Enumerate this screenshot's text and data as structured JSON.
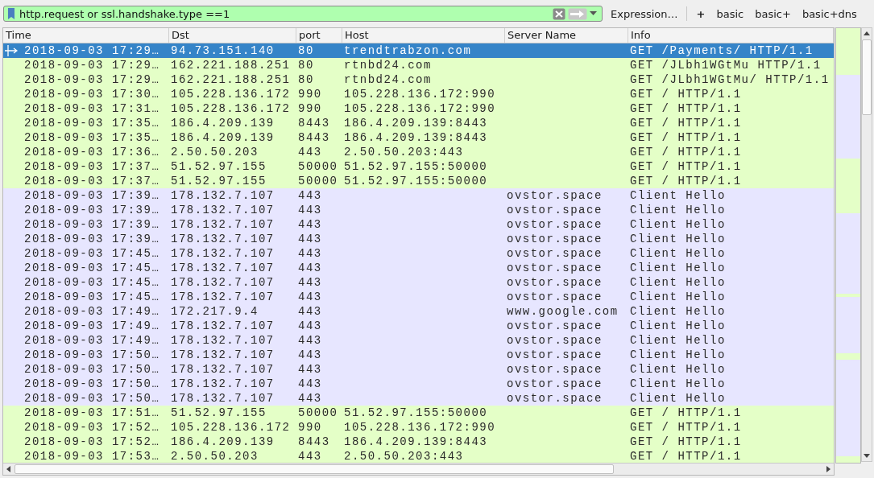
{
  "filter_bar": {
    "value": "http.request or ssl.handshake.type ==1",
    "expression_button": "Expression…",
    "add_button": "+",
    "buttons": [
      "basic",
      "basic+",
      "basic+dns"
    ]
  },
  "table": {
    "columns": [
      "Time",
      "Dst",
      "port",
      "Host",
      "Server Name",
      "Info"
    ],
    "rows": [
      {
        "kind": "http",
        "selected": true,
        "cells": [
          "2018-09-03 17:29…",
          "94.73.151.140",
          "80",
          "trendtrabzon.com",
          "",
          "GET /Payments/ HTTP/1.1"
        ]
      },
      {
        "kind": "http",
        "selected": false,
        "cells": [
          "2018-09-03 17:29…",
          "162.221.188.251",
          "80",
          "rtnbd24.com",
          "",
          "GET /JLbh1WGtMu HTTP/1.1"
        ]
      },
      {
        "kind": "http",
        "selected": false,
        "cells": [
          "2018-09-03 17:29…",
          "162.221.188.251",
          "80",
          "rtnbd24.com",
          "",
          "GET /JLbh1WGtMu/ HTTP/1.1"
        ]
      },
      {
        "kind": "http",
        "selected": false,
        "cells": [
          "2018-09-03 17:30…",
          "105.228.136.172",
          "990",
          "105.228.136.172:990",
          "",
          "GET / HTTP/1.1"
        ]
      },
      {
        "kind": "http",
        "selected": false,
        "cells": [
          "2018-09-03 17:31…",
          "105.228.136.172",
          "990",
          "105.228.136.172:990",
          "",
          "GET / HTTP/1.1"
        ]
      },
      {
        "kind": "http",
        "selected": false,
        "cells": [
          "2018-09-03 17:35…",
          "186.4.209.139",
          "8443",
          "186.4.209.139:8443",
          "",
          "GET / HTTP/1.1"
        ]
      },
      {
        "kind": "http",
        "selected": false,
        "cells": [
          "2018-09-03 17:35…",
          "186.4.209.139",
          "8443",
          "186.4.209.139:8443",
          "",
          "GET / HTTP/1.1"
        ]
      },
      {
        "kind": "http",
        "selected": false,
        "cells": [
          "2018-09-03 17:36…",
          "2.50.50.203",
          "443",
          "2.50.50.203:443",
          "",
          "GET / HTTP/1.1"
        ]
      },
      {
        "kind": "http",
        "selected": false,
        "cells": [
          "2018-09-03 17:37…",
          "51.52.97.155",
          "50000",
          "51.52.97.155:50000",
          "",
          "GET / HTTP/1.1"
        ]
      },
      {
        "kind": "http",
        "selected": false,
        "cells": [
          "2018-09-03 17:37…",
          "51.52.97.155",
          "50000",
          "51.52.97.155:50000",
          "",
          "GET / HTTP/1.1"
        ]
      },
      {
        "kind": "tls",
        "selected": false,
        "cells": [
          "2018-09-03 17:39…",
          "178.132.7.107",
          "443",
          "",
          "ovstor.space",
          "Client Hello"
        ]
      },
      {
        "kind": "tls",
        "selected": false,
        "cells": [
          "2018-09-03 17:39…",
          "178.132.7.107",
          "443",
          "",
          "ovstor.space",
          "Client Hello"
        ]
      },
      {
        "kind": "tls",
        "selected": false,
        "cells": [
          "2018-09-03 17:39…",
          "178.132.7.107",
          "443",
          "",
          "ovstor.space",
          "Client Hello"
        ]
      },
      {
        "kind": "tls",
        "selected": false,
        "cells": [
          "2018-09-03 17:39…",
          "178.132.7.107",
          "443",
          "",
          "ovstor.space",
          "Client Hello"
        ]
      },
      {
        "kind": "tls",
        "selected": false,
        "cells": [
          "2018-09-03 17:45…",
          "178.132.7.107",
          "443",
          "",
          "ovstor.space",
          "Client Hello"
        ]
      },
      {
        "kind": "tls",
        "selected": false,
        "cells": [
          "2018-09-03 17:45…",
          "178.132.7.107",
          "443",
          "",
          "ovstor.space",
          "Client Hello"
        ]
      },
      {
        "kind": "tls",
        "selected": false,
        "cells": [
          "2018-09-03 17:45…",
          "178.132.7.107",
          "443",
          "",
          "ovstor.space",
          "Client Hello"
        ]
      },
      {
        "kind": "tls",
        "selected": false,
        "cells": [
          "2018-09-03 17:45…",
          "178.132.7.107",
          "443",
          "",
          "ovstor.space",
          "Client Hello"
        ]
      },
      {
        "kind": "tls",
        "selected": false,
        "cells": [
          "2018-09-03 17:49…",
          "172.217.9.4",
          "443",
          "",
          "www.google.com",
          "Client Hello"
        ]
      },
      {
        "kind": "tls",
        "selected": false,
        "cells": [
          "2018-09-03 17:49…",
          "178.132.7.107",
          "443",
          "",
          "ovstor.space",
          "Client Hello"
        ]
      },
      {
        "kind": "tls",
        "selected": false,
        "cells": [
          "2018-09-03 17:49…",
          "178.132.7.107",
          "443",
          "",
          "ovstor.space",
          "Client Hello"
        ]
      },
      {
        "kind": "tls",
        "selected": false,
        "cells": [
          "2018-09-03 17:50…",
          "178.132.7.107",
          "443",
          "",
          "ovstor.space",
          "Client Hello"
        ]
      },
      {
        "kind": "tls",
        "selected": false,
        "cells": [
          "2018-09-03 17:50…",
          "178.132.7.107",
          "443",
          "",
          "ovstor.space",
          "Client Hello"
        ]
      },
      {
        "kind": "tls",
        "selected": false,
        "cells": [
          "2018-09-03 17:50…",
          "178.132.7.107",
          "443",
          "",
          "ovstor.space",
          "Client Hello"
        ]
      },
      {
        "kind": "tls",
        "selected": false,
        "cells": [
          "2018-09-03 17:50…",
          "178.132.7.107",
          "443",
          "",
          "ovstor.space",
          "Client Hello"
        ]
      },
      {
        "kind": "http",
        "selected": false,
        "cells": [
          "2018-09-03 17:51…",
          "51.52.97.155",
          "50000",
          "51.52.97.155:50000",
          "",
          "GET / HTTP/1.1"
        ]
      },
      {
        "kind": "http",
        "selected": false,
        "cells": [
          "2018-09-03 17:52…",
          "105.228.136.172",
          "990",
          "105.228.136.172:990",
          "",
          "GET / HTTP/1.1"
        ]
      },
      {
        "kind": "http",
        "selected": false,
        "cells": [
          "2018-09-03 17:52…",
          "186.4.209.139",
          "8443",
          "186.4.209.139:8443",
          "",
          "GET / HTTP/1.1"
        ]
      },
      {
        "kind": "http",
        "selected": false,
        "cells": [
          "2018-09-03 17:53…",
          "2.50.50.203",
          "443",
          "2.50.50.203:443",
          "",
          "GET / HTTP/1.1"
        ]
      }
    ]
  }
}
